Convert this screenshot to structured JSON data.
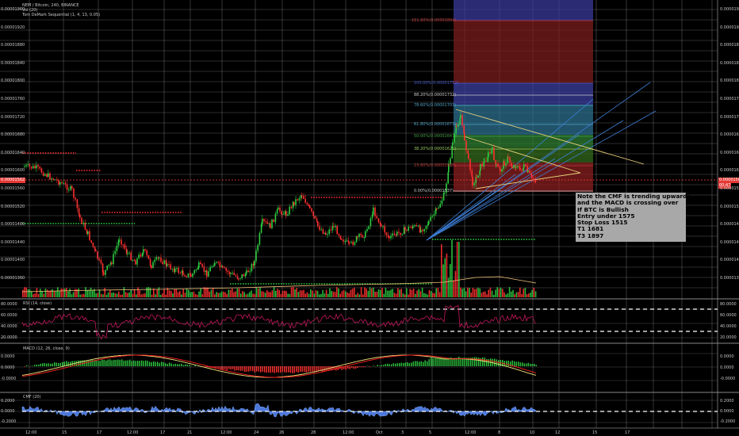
{
  "legend": {
    "symbol": "NEM / Bitcoin, 240, BINANCE",
    "vol": "Vol (20)",
    "td": "Tom DeMark Sequential (1, 4, 13, 0.05)"
  },
  "price_axis": {
    "labels": [
      "0.00001960",
      "0.00001920",
      "0.00001880",
      "0.00001840",
      "0.00001800",
      "0.00001760",
      "0.00001720",
      "0.00001680",
      "0.00001640",
      "0.00001600",
      "0.00001560",
      "0.00001520",
      "0.00001480",
      "0.00001440",
      "0.00001400",
      "0.00001360"
    ],
    "current_price_tag": "0.00001562",
    "current_price_tag_2": "00:47"
  },
  "time_axis": {
    "labels": [
      "12:00",
      "15",
      "17",
      "12:00",
      "17",
      "21",
      "12:00",
      "24",
      "26",
      "28",
      "12:00",
      "Oct",
      "3",
      "5",
      "12:00",
      "8",
      "10",
      "12",
      "15",
      "17"
    ]
  },
  "fib": {
    "levels": [
      {
        "label": "161.80%(0.00001894)",
        "color": "#c23b3b"
      },
      {
        "label": "100.00%(0.00001752)",
        "color": "#4b5bd0"
      },
      {
        "label": "88.20%(0.00001732)",
        "color": "#c8c8c8"
      },
      {
        "label": "78.60%(0.00001703)",
        "color": "#4fa3c7"
      },
      {
        "label": "61.80%(0.00001673)",
        "color": "#4fa3c7"
      },
      {
        "label": "50.00%(0.00001647)",
        "color": "#43a047"
      },
      {
        "label": "38.20%(0.00001621)",
        "color": "#9ccc65"
      },
      {
        "label": "23.60%(0.00001588)",
        "color": "#c23b3b"
      },
      {
        "label": "0.00%(0.00001537)",
        "color": "#c8c8c8"
      }
    ]
  },
  "note": {
    "lines": [
      "Note the CMF is trending upwards",
      "and the MACD is crossing over",
      "If BTC is Bullish",
      "Entry under 1575",
      "Stop Loss 1515",
      "T1 1681",
      "T3 1897"
    ]
  },
  "rsi": {
    "title": "RSI (14, close)",
    "axis": [
      "80.0000",
      "60.0000",
      "40.0000",
      "20.0000"
    ]
  },
  "macd": {
    "title": "MACD (12, 26, close, 9)",
    "axis": [
      "0.0000",
      "0.0000",
      "-0.0000"
    ]
  },
  "cmf": {
    "title": "CMF (20)",
    "axis": [
      "0.2000",
      "0.0000",
      "-0.2000"
    ]
  },
  "colors": {
    "bull": "#2ecc40",
    "bear": "#ff3030",
    "grid": "#ffffff",
    "rsi_line": "#c2185b",
    "macd_line": "#f5e27a",
    "signal_line": "#ff2020",
    "cmf_fill": "#5b8cff"
  }
}
